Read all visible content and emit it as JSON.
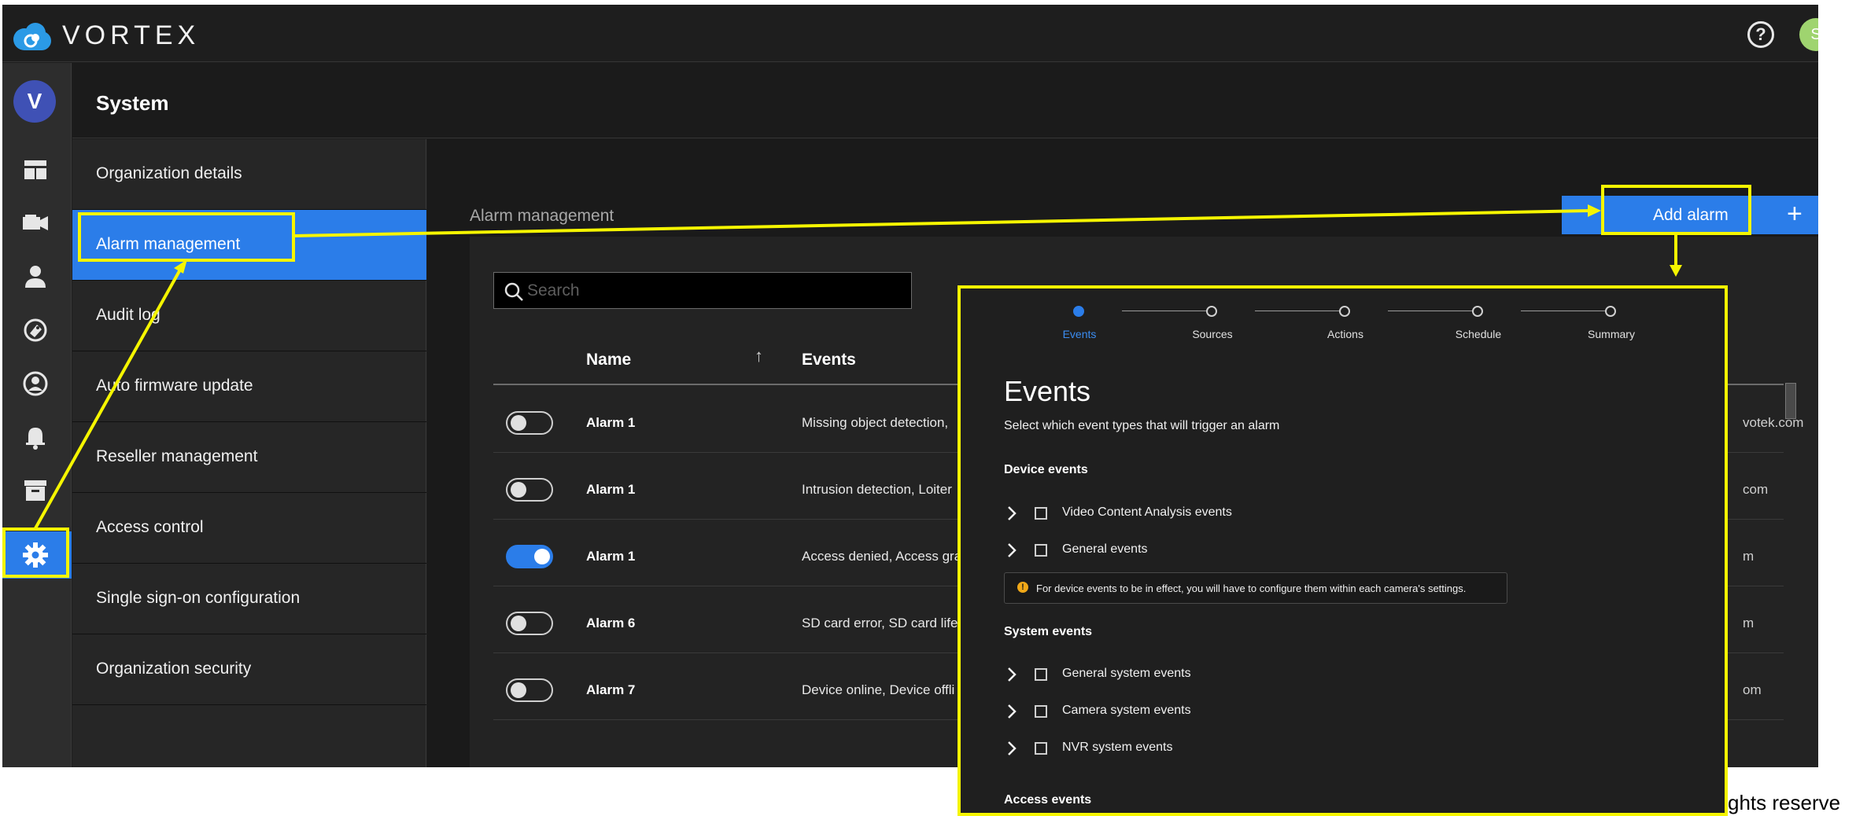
{
  "app": {
    "brand": "VORTEX",
    "help_icon": "help-circle-icon",
    "user_initial": "S",
    "org_initial": "V"
  },
  "rail": {
    "icons": [
      "dashboard-icon",
      "camera-icon",
      "user-icon",
      "tags-icon",
      "user-circle-icon",
      "bell-icon",
      "archive-icon",
      "gear-icon"
    ],
    "active": "gear-icon"
  },
  "page": {
    "title": "System"
  },
  "menu": {
    "items": [
      "Organization details",
      "Alarm management",
      "Audit log",
      "Auto firmware update",
      "Reseller management",
      "Access control",
      "Single sign-on configuration",
      "Organization security"
    ],
    "active": "Alarm management"
  },
  "content": {
    "section_label": "Alarm management",
    "add_button": "Add alarm",
    "add_plus": "+",
    "search_placeholder": "Search",
    "columns": {
      "name": "Name",
      "sort": "↑",
      "events": "Events"
    },
    "rows": [
      {
        "enabled": false,
        "name": "Alarm 1",
        "events": "Missing object detection,",
        "tail": "votek.com"
      },
      {
        "enabled": false,
        "name": "Alarm 1",
        "events": "Intrusion detection, Loiter",
        "tail": "com"
      },
      {
        "enabled": true,
        "name": "Alarm 1",
        "events": "Access denied, Access gra",
        "tail": "m"
      },
      {
        "enabled": false,
        "name": "Alarm 6",
        "events": "SD card error, SD card life",
        "tail": "m"
      },
      {
        "enabled": false,
        "name": "Alarm 7",
        "events": "Device online, Device offli",
        "tail": "om"
      }
    ]
  },
  "wizard": {
    "steps": [
      "Events",
      "Sources",
      "Actions",
      "Schedule",
      "Summary"
    ],
    "active_step": "Events",
    "title": "Events",
    "description": "Select which event types that will trigger an alarm",
    "device_section": "Device events",
    "device_items": [
      "Video Content Analysis events",
      "General events"
    ],
    "note": "For device events to be in effect, you will have to configure them within each camera's settings.",
    "system_section": "System events",
    "system_items": [
      "General system events",
      "Camera system events",
      "NVR system events"
    ],
    "access_section": "Access events"
  },
  "footer": {
    "copyright_fragment": "ghts reserve"
  },
  "colors": {
    "accent": "#2b7de9",
    "annotation": "#f5f500",
    "background": "#1d1d1d",
    "success_avatar": "#9fd46f",
    "org_avatar": "#3f51b5"
  }
}
